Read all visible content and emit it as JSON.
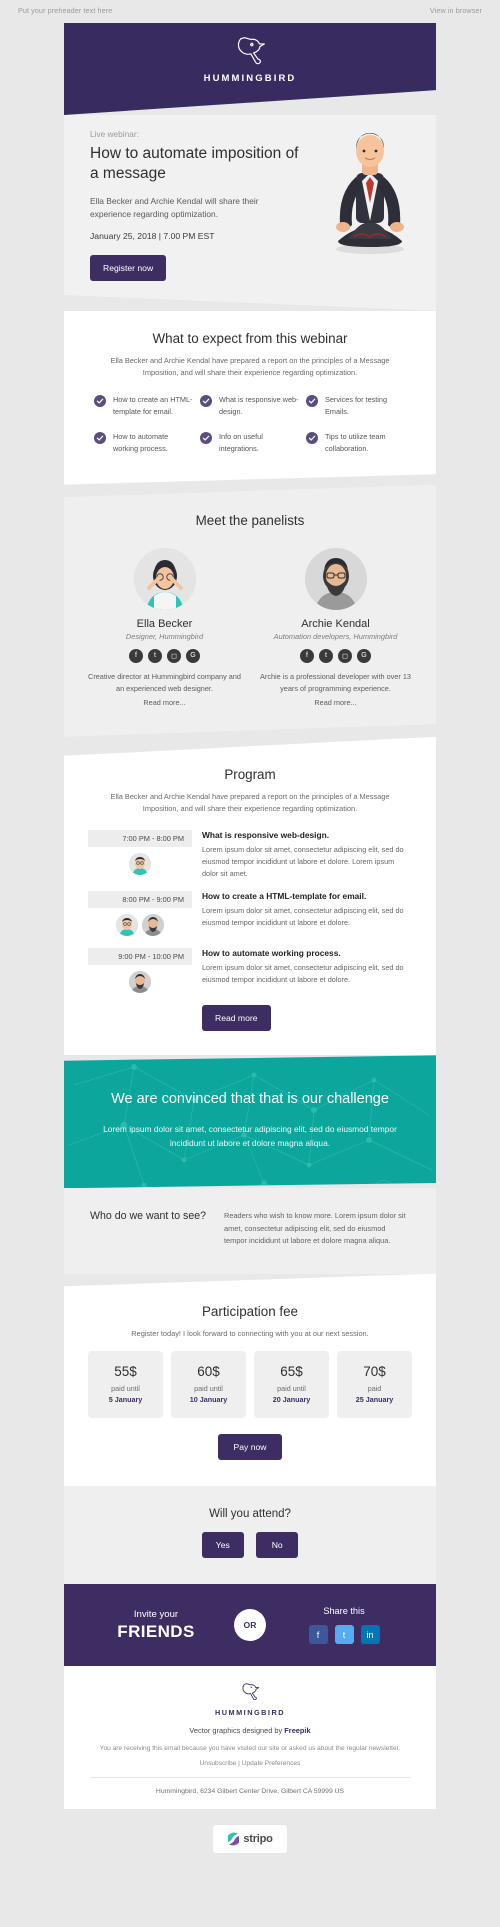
{
  "preheader": {
    "left": "Put your preheader text here",
    "right": "View in browser"
  },
  "brand": {
    "name": "HUMMINGBIRD",
    "purple": "#3d2d63",
    "teal": "#0ca69d"
  },
  "hero": {
    "eyebrow": "Live webinar:",
    "title": "How to automate imposition of a message",
    "desc": "Ella Becker and Archie Kendal will share their experience regarding optimization.",
    "date": "January 25, 2018 | 7.00 PM EST",
    "cta": "Register now"
  },
  "expect": {
    "title": "What to expect from this webinar",
    "subtitle": "Ella Becker and Archie Kendal have prepared a report on the principles of a Message Imposition, and will share their experience regarding optimization.",
    "columns": [
      [
        "How to create an HTML-template for email.",
        "How to automate working process."
      ],
      [
        "What is responsive web-design.",
        "Info on useful integrations."
      ],
      [
        "Services for testing Emails.",
        "Tips to utilize team collaboration."
      ]
    ]
  },
  "panelists": {
    "title": "Meet the panelists",
    "people": [
      {
        "name": "Ella Becker",
        "role": "Designer, Hummingbird",
        "bio": "Creative director at Hummingbird company and an experienced web designer.",
        "readmore": "Read more...",
        "socials": [
          "facebook-icon",
          "twitter-icon",
          "instagram-icon",
          "google-plus-icon"
        ]
      },
      {
        "name": "Archie Kendal",
        "role": "Automation developers, Hummingbird",
        "bio": "Archie is a professional developer with over 13 years of programming experience.",
        "readmore": "Read more...",
        "socials": [
          "facebook-icon",
          "twitter-icon",
          "instagram-icon",
          "google-plus-icon"
        ]
      }
    ]
  },
  "program": {
    "title": "Program",
    "subtitle": "Ella Becker and Archie Kendal have prepared a report on the principles of a Message Imposition, and will share their experience regarding optimization.",
    "rows": [
      {
        "time": "7:00 PM - 8:00 PM",
        "title": "What is responsive web-design.",
        "body": "Lorem ipsum dolor sit amet, consectetur adipiscing elit, sed do eiusmod tempor incididunt ut labore et dolore. Lorem ipsum dolor sit amet.",
        "faces": 1
      },
      {
        "time": "8:00 PM - 9:00 PM",
        "title": "How to create a HTML-template for email.",
        "body": "Lorem ipsum dolor sit amet, consectetur adipiscing elit, sed do eiusmod tempor incididunt ut labore et dolore.",
        "faces": 2
      },
      {
        "time": "9:00 PM - 10:00 PM",
        "title": "How to automate working process.",
        "body": "Lorem ipsum dolor sit amet, consectetur adipiscing elit, sed do eiusmod tempor incididunt ut labore et dolore.",
        "faces": 1
      }
    ],
    "cta": "Read more"
  },
  "challenge": {
    "heading": "We are convinced that that is our challenge",
    "body": "Lorem ipsum dolor sit amet, consectetur adipiscing elit, sed do eiusmod tempor incididunt ut labore et dolore magna aliqua."
  },
  "audience": {
    "question": "Who do we want to see?",
    "answer": "Readers who wish to know more. Lorem ipsum dolor sit amet, consectetur adipiscing elit, sed do eiusmod tempor incididunt ut labore et dolore magna aliqua."
  },
  "fee": {
    "title": "Participation fee",
    "subtitle": "Register today! I look forward to connecting with you at our next session.",
    "tiers": [
      {
        "amount": "55$",
        "label": "paid until",
        "date": "5 January"
      },
      {
        "amount": "60$",
        "label": "paid until",
        "date": "10 January"
      },
      {
        "amount": "65$",
        "label": "paid until",
        "date": "20 January"
      },
      {
        "amount": "70$",
        "label": "paid",
        "date": "25 January"
      }
    ],
    "cta": "Pay now"
  },
  "attend": {
    "question": "Will you attend?",
    "yes": "Yes",
    "no": "No"
  },
  "invite": {
    "small": "Invite your",
    "big": "FRIENDS",
    "or": "OR",
    "share_label": "Share this",
    "share_icons": [
      "facebook-icon",
      "twitter-icon",
      "linkedin-icon"
    ]
  },
  "footer": {
    "brand": "HUMMINGBIRD",
    "credit_pre": "Vector graphics designed by ",
    "credit_link": "Freepik",
    "note": "You are receiving this email because you have visited our site or asked us about the regular newsletter.",
    "unsubscribe": "Unsubscribe",
    "separator": " | ",
    "preferences": "Update Preferences",
    "address": "Hummingbird, 6234 Gilbert Center Drive, Gilbert CA 59999 US"
  },
  "stripo": {
    "word": "stripo"
  }
}
